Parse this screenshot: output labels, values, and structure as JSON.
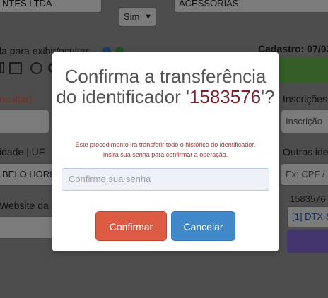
{
  "background": {
    "company_name": "NTES LTDA",
    "select_value": "Sim",
    "category": "ACESSORIAS",
    "toggle_hint": "la para exibir/ocultar:",
    "cadastro": "Cadastro: 07/03",
    "ocultar_link": "ocultar)",
    "inscricoes_label": "Inscrições",
    "inscricao_placeholder": "Inscrição",
    "cidade_uf_label": "idade | UF",
    "city_value": "BELO HORIZ",
    "outros_label": "Outros ide",
    "outros_placeholder": "Ex:  CPF /",
    "id_value": "1583576",
    "dtx_value": "[1] DTX S",
    "website_label": "Website da e"
  },
  "modal": {
    "title_prefix": "Confirma a transferência do identificador '",
    "identifier": "1583576",
    "title_suffix": "'?",
    "message_line1": "Este procedimento irá transferir todo o histórico do identificador.",
    "message_line2": "Insira sua senha para confirmar a operação.",
    "password_placeholder": "Confirme sua senha",
    "confirm_label": "Confirmar",
    "cancel_label": "Cancelar"
  },
  "colors": {
    "overlay": "#000000",
    "confirm_button": "#dd5a43",
    "cancel_button": "#3f88c9",
    "identifier_text": "#7a1e2c",
    "message_text": "#b03030"
  }
}
